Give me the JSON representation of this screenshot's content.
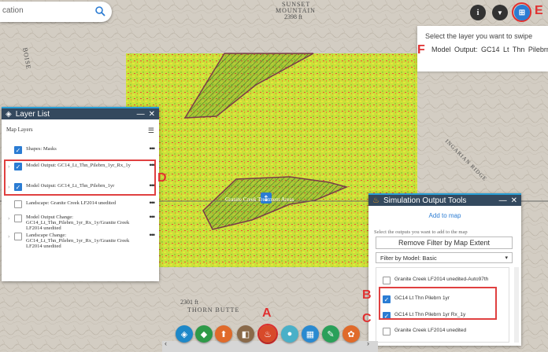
{
  "search": {
    "value": "cation"
  },
  "map": {
    "labels": [
      {
        "text": "SUNSET"
      },
      {
        "text": "MOUNTAIN"
      },
      {
        "text": "2398 ft"
      },
      {
        "text": "Granite Creek Treatment Areas"
      },
      {
        "text": "2301 ft"
      },
      {
        "text": "THORN BUTTE"
      },
      {
        "text": "BOISE"
      },
      {
        "text": "INGARIAN RIDGE"
      }
    ]
  },
  "toolbar": {
    "info": "i",
    "filter": "▼",
    "swipe": "⊞"
  },
  "swipe": {
    "prompt": "Select the layer you want to swipe",
    "layer": "Model Output: GC14 Lt Thn Pilebrn"
  },
  "annotations": {
    "a": "A",
    "b": "B",
    "c": "C",
    "d": "D",
    "e": "E",
    "f": "F"
  },
  "layer_list": {
    "title": "Layer List",
    "subtitle": "Map Layers",
    "layers": [
      {
        "label": "Shapes: Masks",
        "checked": "✓"
      },
      {
        "label": "Model Output: GC14_Lt_Thn_Pilebrn_1yr_Rx_1y",
        "checked": "✓"
      },
      {
        "label": "Model Output: GC14_Lt_Thn_Pilebrn_1yr",
        "checked": "✓"
      },
      {
        "label": "Landscape: Granite Creek LF2014 unedited",
        "checked": ""
      },
      {
        "label": "Model Output Change: GC14_Lt_Thn_Pilebrn_1yr_Rx_1y/Granite Creek LF2014 unedited",
        "checked": ""
      },
      {
        "label": "Landscape Change: GC14_Lt_Thn_Pilebrn_1yr_Rx_1y/Granite Creek LF2014 unedited",
        "checked": ""
      }
    ]
  },
  "sim": {
    "title": "Simulation Output Tools",
    "add_link": "Add to map",
    "instruction": "Select the outputs you want to add to the map",
    "remove_filter": "Remove Filter by Map Extent",
    "filter_select": "Filter by Model: Basic",
    "items": [
      {
        "label": "Granite Creek LF2014 unedited-Auto97th",
        "checked": ""
      },
      {
        "label": "GC14  Lt  Thn  Pilebrn  1yr",
        "checked": "✓"
      },
      {
        "label": "GC14  Lt Thn  Pilebrn  1yr  Rx_1y",
        "checked": "✓"
      },
      {
        "label": "Granite Creek LF2014 unedited",
        "checked": ""
      }
    ]
  },
  "colors": {
    "header": "#34495e",
    "accent": "#2b7cd3",
    "annotation": "#e03030"
  },
  "dock": [
    {
      "icon": "layers-icon",
      "color": "#1e88c8"
    },
    {
      "icon": "basemap-icon",
      "color": "#2e9a48"
    },
    {
      "icon": "upload-icon",
      "color": "#e06a2a"
    },
    {
      "icon": "legend-icon",
      "color": "#8a6a4a"
    },
    {
      "icon": "fire-icon",
      "color": "#d84a2a"
    },
    {
      "icon": "pin-icon",
      "color": "#4ab0c8"
    },
    {
      "icon": "grid-icon",
      "color": "#2a8ad0"
    },
    {
      "icon": "edit-icon",
      "color": "#2aa05a"
    },
    {
      "icon": "palette-icon",
      "color": "#e06a2a"
    }
  ]
}
